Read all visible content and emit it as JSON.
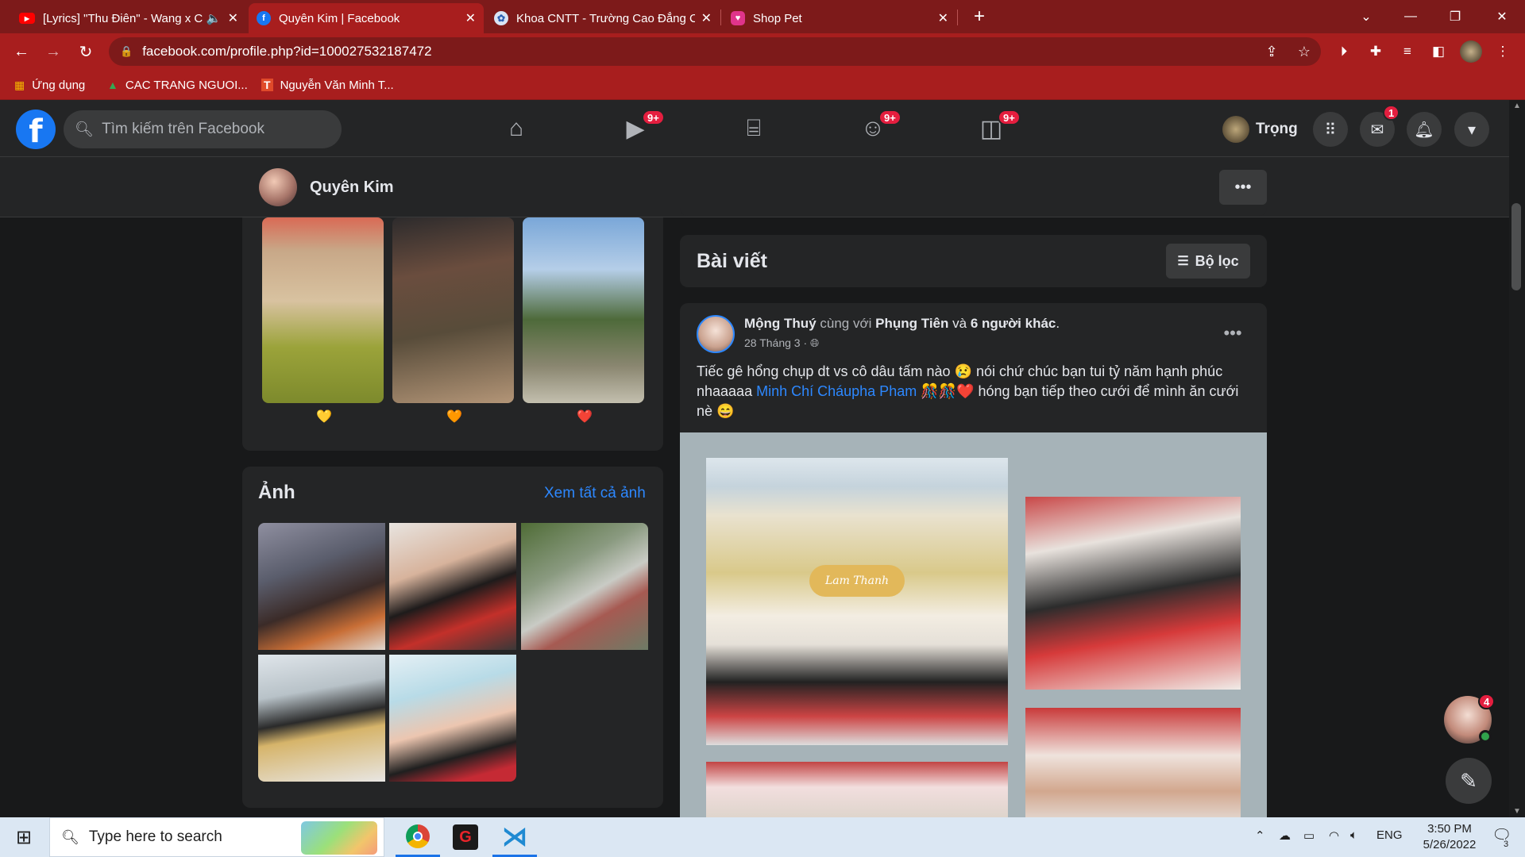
{
  "browser": {
    "tabs": [
      {
        "title": "[Lyrics] \"Thu Điên\" - Wang x C",
        "icon": "youtube-icon",
        "audio": "🔈"
      },
      {
        "title": "Quyên Kim | Facebook",
        "icon": "facebook-icon"
      },
      {
        "title": "Khoa CNTT - Trường Cao Đẳng C",
        "icon": "college-icon"
      },
      {
        "title": "Shop Pet",
        "icon": "shop-pet-icon"
      }
    ],
    "url": "facebook.com/profile.php?id=100027532187472",
    "bookmarks": [
      {
        "label": "Ứng dụng",
        "icon": "apps-grid-icon"
      },
      {
        "label": "CAC TRANG NGUOI...",
        "icon": "google-drive-icon"
      },
      {
        "label": "Nguyễn Văn Minh T...",
        "icon": "bookmark-t-icon"
      }
    ],
    "colors": {
      "frame": "#7d1a1a",
      "toolbar": "#a81e1e"
    }
  },
  "facebook": {
    "search_placeholder": "Tìm kiếm trên Facebook",
    "nav_badges": {
      "watch": "9+",
      "groups": "9+",
      "gaming": "9+"
    },
    "user_name": "Trọng",
    "messenger_badge": "1",
    "colors": {
      "brand": "#1877f2",
      "background": "#18191a",
      "card": "#242526",
      "link": "#2d88ff",
      "badge": "#e41e3f"
    }
  },
  "profile": {
    "name": "Quyên Kim",
    "featured_hearts": [
      "💛",
      "🧡",
      "❤️"
    ],
    "photos_title": "Ảnh",
    "see_all_photos": "Xem tất cả ảnh"
  },
  "posts": {
    "title": "Bài viết",
    "filter_label": "Bộ lọc",
    "post": {
      "author": "Mộng Thuý",
      "with_text": "cùng với",
      "tagged": "Phụng Tiên",
      "and_text": "và",
      "others": "6 người khác",
      "period": ".",
      "date": "28 Tháng 3 ·",
      "text_before": "Tiếc gê hổng chụp dt vs cô dâu tấm nào 😢 nói chứ chúc bạn tui tỷ năm hạnh phúc nhaaaaa",
      "mention": "Minh Chí Cháupha Pham",
      "text_after": "🎊🎊❤️ hóng bạn tiếp theo cưới để mình ăn cưới nè 😄",
      "banner_text": "Lam Thanh"
    }
  },
  "chat": {
    "badge": "4"
  },
  "taskbar": {
    "search_placeholder": "Type here to search",
    "language": "ENG",
    "time": "3:50 PM",
    "date": "5/26/2022",
    "notifications": "3"
  }
}
